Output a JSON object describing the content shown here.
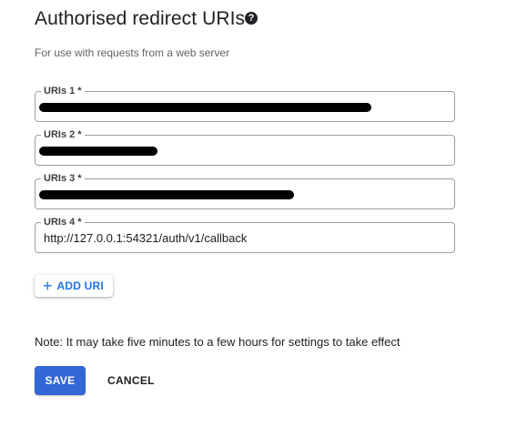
{
  "section": {
    "title": "Authorised redirect URIs",
    "help_icon_glyph": "?",
    "subtitle": "For use with requests from a web server"
  },
  "uris": [
    {
      "label": "URIs 1 *",
      "value": "",
      "redacted": true
    },
    {
      "label": "URIs 2 *",
      "value": "",
      "redacted": true
    },
    {
      "label": "URIs 3 *",
      "value": "",
      "redacted": true
    },
    {
      "label": "URIs 4 *",
      "value": "http://127.0.0.1:54321/auth/v1/callback",
      "redacted": false
    }
  ],
  "add_uri": {
    "icon": "plus-icon",
    "icon_glyph": "+",
    "label": "ADD URI"
  },
  "note": "Note: It may take five minutes to a few hours for settings to take effect",
  "actions": {
    "save_label": "SAVE",
    "cancel_label": "CANCEL"
  },
  "colors": {
    "primary": "#3367d6",
    "link": "#1a73e8",
    "redaction": "#000000"
  }
}
